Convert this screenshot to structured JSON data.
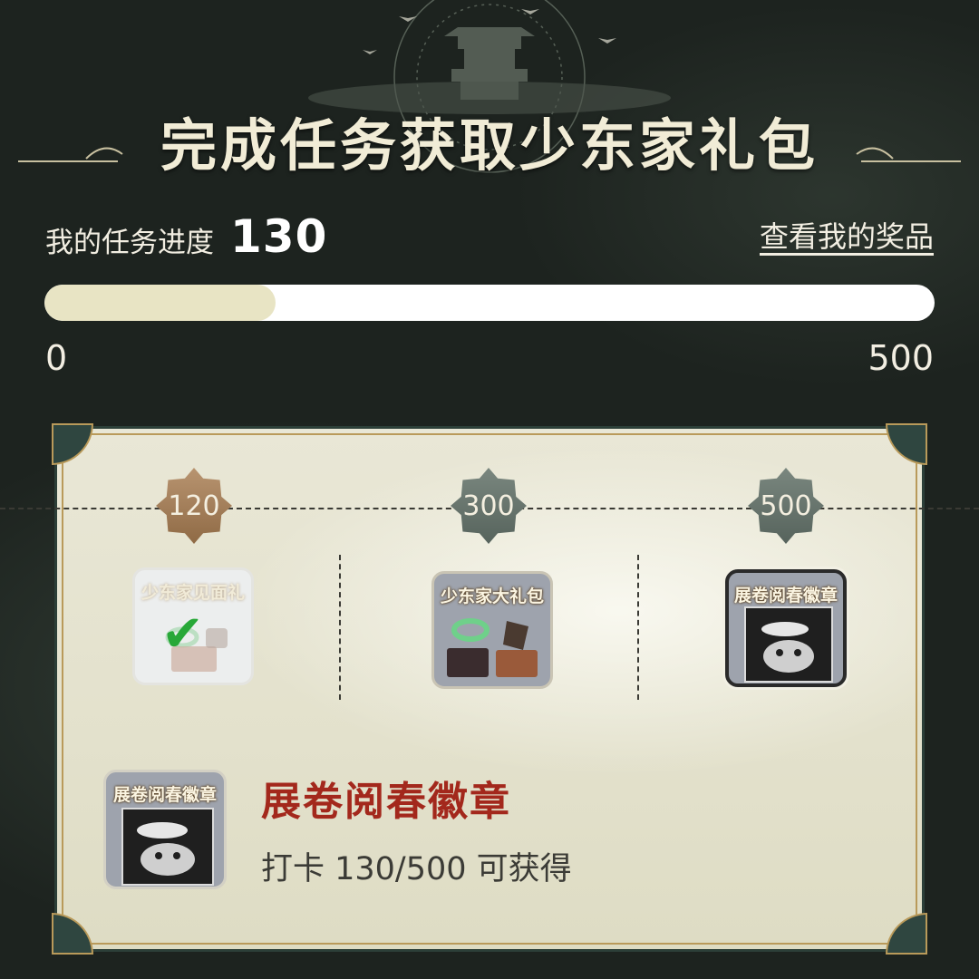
{
  "header": {
    "title": "完成任务获取少东家礼包"
  },
  "progress": {
    "label": "我的任务进度",
    "value": "130",
    "current": 130,
    "min_label": "0",
    "max_label": "500",
    "max": 500,
    "fraction": 0.26,
    "prizes_link": "查看我的奖品"
  },
  "milestones": [
    {
      "value": "120",
      "state": "completed",
      "reward_label": "少东家见面礼",
      "claimed": true
    },
    {
      "value": "300",
      "state": "locked",
      "reward_label": "少东家大礼包",
      "claimed": false
    },
    {
      "value": "500",
      "state": "locked",
      "reward_label": "展卷阅春徽章",
      "claimed": false,
      "selected": true
    }
  ],
  "detail": {
    "card_label": "展卷阅春徽章",
    "title": "展卷阅春徽章",
    "description": "打卡 130/500 可获得"
  },
  "colors": {
    "background": "#1d231f",
    "panel": "#e5e3cf",
    "accent_red": "#a3281c",
    "check_green": "#28a838"
  }
}
